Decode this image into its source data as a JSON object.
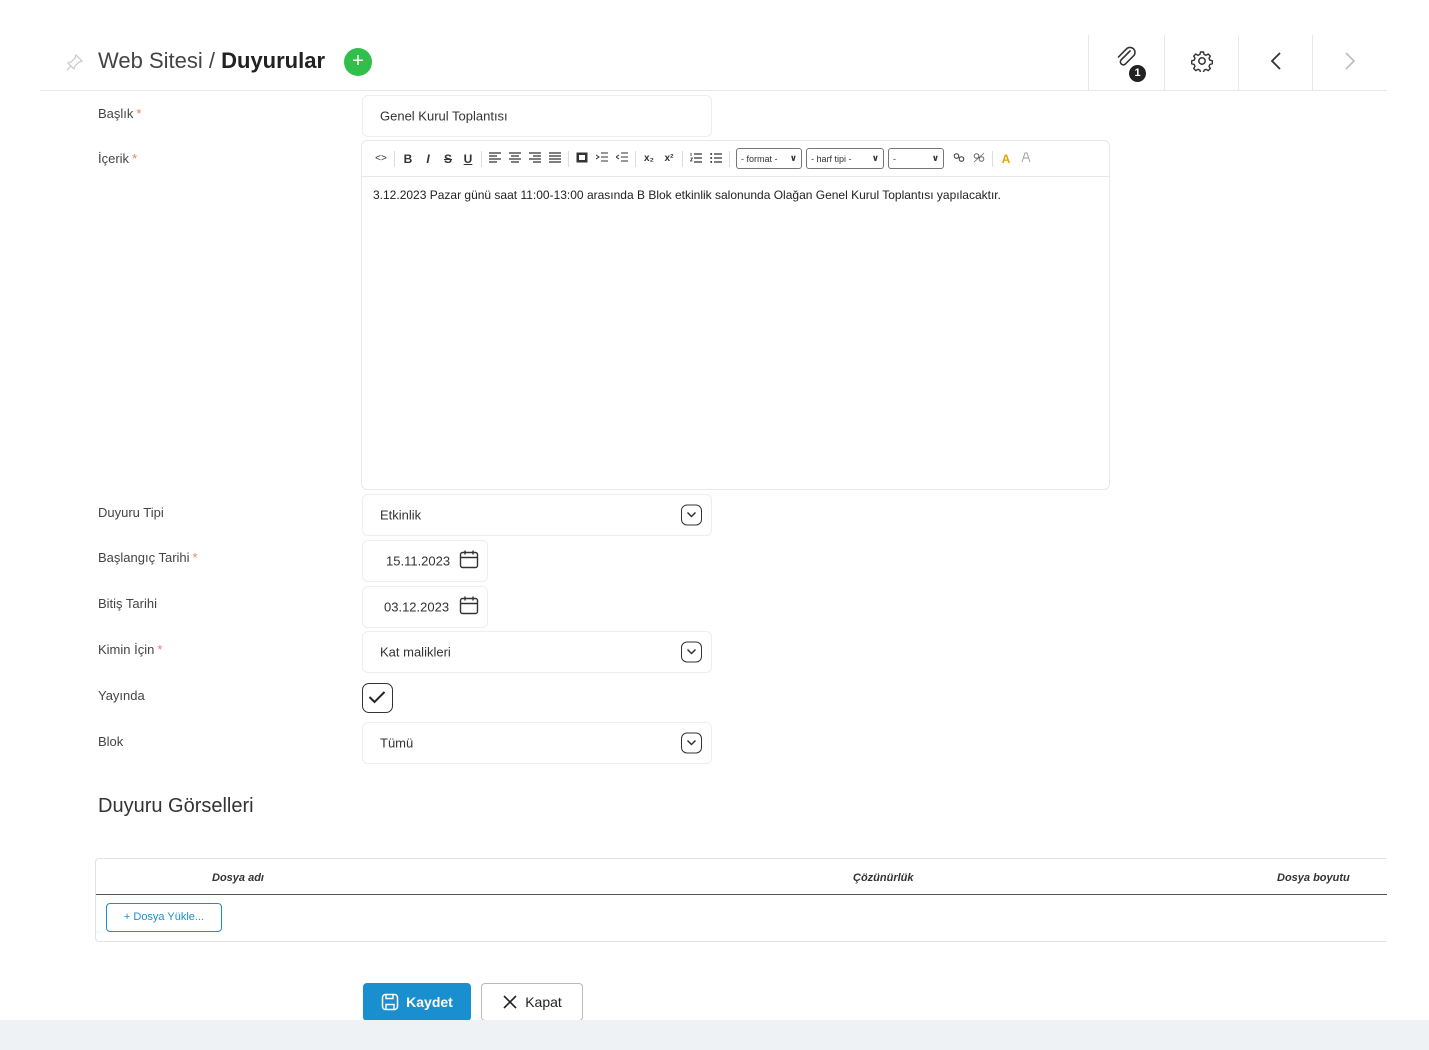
{
  "header": {
    "breadcrumb_root": "Web Sitesi",
    "separator": "/",
    "breadcrumb_current": "Duyurular",
    "add_label": "+",
    "attachment_count": "1"
  },
  "form": {
    "title_label": "Başlık",
    "title_value": "Genel Kurul Toplantısı",
    "content_label": "İçerik",
    "content_text": "3.12.2023 Pazar günü saat 11:00-13:00 arasında B Blok etkinlik salonunda Olağan Genel Kurul Toplantısı yapılacaktır.",
    "type_label": "Duyuru Tipi",
    "type_value": "Etkinlik",
    "start_label": "Başlangıç Tarihi",
    "start_value": "15.11.2023",
    "end_label": "Bitiş Tarihi",
    "end_value": "03.12.2023",
    "audience_label": "Kimin İçin",
    "audience_value": "Kat malikleri",
    "published_label": "Yayında",
    "published": true,
    "block_label": "Blok",
    "block_value": "Tümü",
    "required_mark": "*"
  },
  "editor_toolbar": {
    "code": "<>",
    "bold": "B",
    "italic": "I",
    "strike": "S",
    "underline": "U",
    "format_select": "- format -",
    "font_select": "- harf tipi -",
    "size_select": "-",
    "subscript": "x₂",
    "superscript": "x²"
  },
  "images_section": {
    "title": "Duyuru Görselleri",
    "columns": [
      "Dosya adı",
      "Çözünürlük",
      "Dosya boyutu"
    ],
    "upload_label": "+ Dosya Yükle..."
  },
  "actions": {
    "save_label": "Kaydet",
    "close_label": "Kapat"
  },
  "colors": {
    "primary": "#1a8fd0",
    "add_green": "#2fbf4a",
    "required": "#f07c6c"
  },
  "icons": [
    "pin-icon",
    "plus-icon",
    "paperclip-icon",
    "gear-icon",
    "chevron-left-icon",
    "chevron-right-icon",
    "calendar-icon",
    "chevron-down-icon",
    "check-icon",
    "save-icon",
    "close-icon"
  ]
}
